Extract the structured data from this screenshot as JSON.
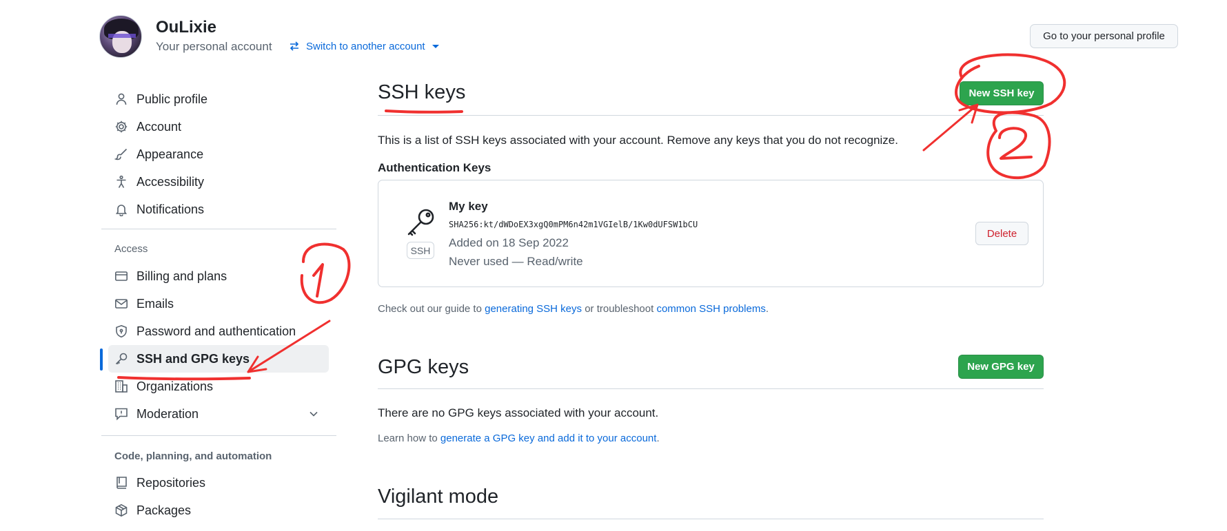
{
  "header": {
    "user_name": "OuLixie",
    "account_type": "Your personal account",
    "switch_label": "Switch to another account",
    "profile_button": "Go to your personal profile"
  },
  "sidebar": {
    "items_top": [
      {
        "label": "Public profile",
        "icon": "person-icon"
      },
      {
        "label": "Account",
        "icon": "gear-icon"
      },
      {
        "label": "Appearance",
        "icon": "paintbrush-icon"
      },
      {
        "label": "Accessibility",
        "icon": "accessibility-icon"
      },
      {
        "label": "Notifications",
        "icon": "bell-icon"
      }
    ],
    "access_heading": "Access",
    "items_access": [
      {
        "label": "Billing and plans",
        "icon": "credit-card-icon"
      },
      {
        "label": "Emails",
        "icon": "mail-icon"
      },
      {
        "label": "Password and authentication",
        "icon": "shield-lock-icon"
      },
      {
        "label": "SSH and GPG keys",
        "icon": "key-icon",
        "active": true
      },
      {
        "label": "Organizations",
        "icon": "organization-icon"
      },
      {
        "label": "Moderation",
        "icon": "report-icon"
      }
    ],
    "code_heading": "Code, planning, and automation",
    "items_code": [
      {
        "label": "Repositories",
        "icon": "repo-icon"
      },
      {
        "label": "Packages",
        "icon": "package-icon"
      }
    ]
  },
  "ssh": {
    "title": "SSH keys",
    "new_button": "New SSH key",
    "description": "This is a list of SSH keys associated with your account. Remove any keys that you do not recognize.",
    "auth_heading": "Authentication Keys",
    "key": {
      "name": "My key",
      "badge": "SSH",
      "fingerprint": "SHA256:kt/dWDoEX3xgQ0mPM6n42m1VGIelB/1Kw0dUFSW1bCU",
      "added": "Added on 18 Sep 2022",
      "usage": "Never used — Read/write",
      "delete_button": "Delete"
    },
    "guide_prefix": "Check out our guide to ",
    "guide_link1": "generating SSH keys",
    "guide_mid": " or troubleshoot ",
    "guide_link2": "common SSH problems",
    "guide_suffix": "."
  },
  "gpg": {
    "title": "GPG keys",
    "new_button": "New GPG key",
    "empty_text": "There are no GPG keys associated with your account.",
    "learn_prefix": "Learn how to ",
    "learn_link": "generate a GPG key and add it to your account",
    "learn_suffix": "."
  },
  "vigilant": {
    "title": "Vigilant mode"
  },
  "annotations": {
    "color": "#f0302f",
    "marks": [
      "①",
      "②"
    ]
  },
  "colors": {
    "accent": "#0969da",
    "green": "#2da44e",
    "danger": "#cf222e"
  }
}
